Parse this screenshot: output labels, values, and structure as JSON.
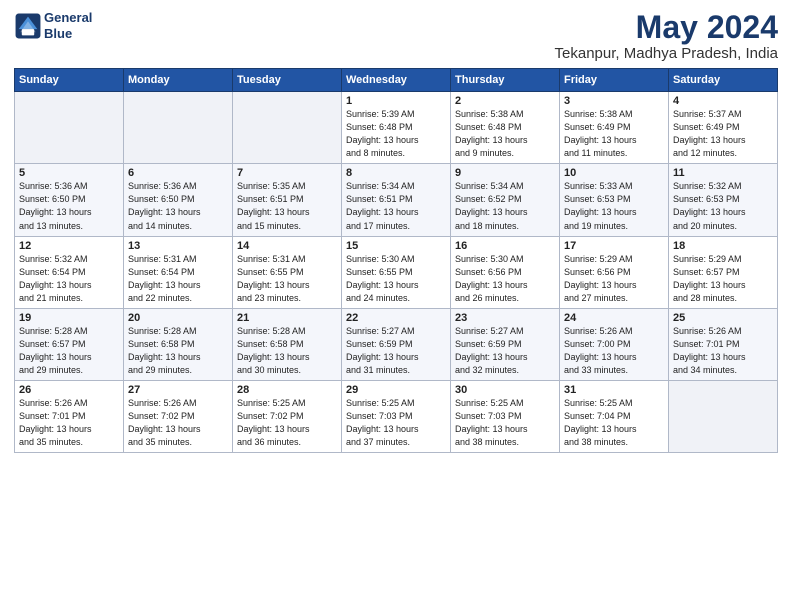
{
  "header": {
    "logo_line1": "General",
    "logo_line2": "Blue",
    "title": "May 2024",
    "subtitle": "Tekanpur, Madhya Pradesh, India"
  },
  "weekdays": [
    "Sunday",
    "Monday",
    "Tuesday",
    "Wednesday",
    "Thursday",
    "Friday",
    "Saturday"
  ],
  "weeks": [
    [
      {
        "day": "",
        "detail": ""
      },
      {
        "day": "",
        "detail": ""
      },
      {
        "day": "",
        "detail": ""
      },
      {
        "day": "1",
        "detail": "Sunrise: 5:39 AM\nSunset: 6:48 PM\nDaylight: 13 hours\nand 8 minutes."
      },
      {
        "day": "2",
        "detail": "Sunrise: 5:38 AM\nSunset: 6:48 PM\nDaylight: 13 hours\nand 9 minutes."
      },
      {
        "day": "3",
        "detail": "Sunrise: 5:38 AM\nSunset: 6:49 PM\nDaylight: 13 hours\nand 11 minutes."
      },
      {
        "day": "4",
        "detail": "Sunrise: 5:37 AM\nSunset: 6:49 PM\nDaylight: 13 hours\nand 12 minutes."
      }
    ],
    [
      {
        "day": "5",
        "detail": "Sunrise: 5:36 AM\nSunset: 6:50 PM\nDaylight: 13 hours\nand 13 minutes."
      },
      {
        "day": "6",
        "detail": "Sunrise: 5:36 AM\nSunset: 6:50 PM\nDaylight: 13 hours\nand 14 minutes."
      },
      {
        "day": "7",
        "detail": "Sunrise: 5:35 AM\nSunset: 6:51 PM\nDaylight: 13 hours\nand 15 minutes."
      },
      {
        "day": "8",
        "detail": "Sunrise: 5:34 AM\nSunset: 6:51 PM\nDaylight: 13 hours\nand 17 minutes."
      },
      {
        "day": "9",
        "detail": "Sunrise: 5:34 AM\nSunset: 6:52 PM\nDaylight: 13 hours\nand 18 minutes."
      },
      {
        "day": "10",
        "detail": "Sunrise: 5:33 AM\nSunset: 6:53 PM\nDaylight: 13 hours\nand 19 minutes."
      },
      {
        "day": "11",
        "detail": "Sunrise: 5:32 AM\nSunset: 6:53 PM\nDaylight: 13 hours\nand 20 minutes."
      }
    ],
    [
      {
        "day": "12",
        "detail": "Sunrise: 5:32 AM\nSunset: 6:54 PM\nDaylight: 13 hours\nand 21 minutes."
      },
      {
        "day": "13",
        "detail": "Sunrise: 5:31 AM\nSunset: 6:54 PM\nDaylight: 13 hours\nand 22 minutes."
      },
      {
        "day": "14",
        "detail": "Sunrise: 5:31 AM\nSunset: 6:55 PM\nDaylight: 13 hours\nand 23 minutes."
      },
      {
        "day": "15",
        "detail": "Sunrise: 5:30 AM\nSunset: 6:55 PM\nDaylight: 13 hours\nand 24 minutes."
      },
      {
        "day": "16",
        "detail": "Sunrise: 5:30 AM\nSunset: 6:56 PM\nDaylight: 13 hours\nand 26 minutes."
      },
      {
        "day": "17",
        "detail": "Sunrise: 5:29 AM\nSunset: 6:56 PM\nDaylight: 13 hours\nand 27 minutes."
      },
      {
        "day": "18",
        "detail": "Sunrise: 5:29 AM\nSunset: 6:57 PM\nDaylight: 13 hours\nand 28 minutes."
      }
    ],
    [
      {
        "day": "19",
        "detail": "Sunrise: 5:28 AM\nSunset: 6:57 PM\nDaylight: 13 hours\nand 29 minutes."
      },
      {
        "day": "20",
        "detail": "Sunrise: 5:28 AM\nSunset: 6:58 PM\nDaylight: 13 hours\nand 29 minutes."
      },
      {
        "day": "21",
        "detail": "Sunrise: 5:28 AM\nSunset: 6:58 PM\nDaylight: 13 hours\nand 30 minutes."
      },
      {
        "day": "22",
        "detail": "Sunrise: 5:27 AM\nSunset: 6:59 PM\nDaylight: 13 hours\nand 31 minutes."
      },
      {
        "day": "23",
        "detail": "Sunrise: 5:27 AM\nSunset: 6:59 PM\nDaylight: 13 hours\nand 32 minutes."
      },
      {
        "day": "24",
        "detail": "Sunrise: 5:26 AM\nSunset: 7:00 PM\nDaylight: 13 hours\nand 33 minutes."
      },
      {
        "day": "25",
        "detail": "Sunrise: 5:26 AM\nSunset: 7:01 PM\nDaylight: 13 hours\nand 34 minutes."
      }
    ],
    [
      {
        "day": "26",
        "detail": "Sunrise: 5:26 AM\nSunset: 7:01 PM\nDaylight: 13 hours\nand 35 minutes."
      },
      {
        "day": "27",
        "detail": "Sunrise: 5:26 AM\nSunset: 7:02 PM\nDaylight: 13 hours\nand 35 minutes."
      },
      {
        "day": "28",
        "detail": "Sunrise: 5:25 AM\nSunset: 7:02 PM\nDaylight: 13 hours\nand 36 minutes."
      },
      {
        "day": "29",
        "detail": "Sunrise: 5:25 AM\nSunset: 7:03 PM\nDaylight: 13 hours\nand 37 minutes."
      },
      {
        "day": "30",
        "detail": "Sunrise: 5:25 AM\nSunset: 7:03 PM\nDaylight: 13 hours\nand 38 minutes."
      },
      {
        "day": "31",
        "detail": "Sunrise: 5:25 AM\nSunset: 7:04 PM\nDaylight: 13 hours\nand 38 minutes."
      },
      {
        "day": "",
        "detail": ""
      }
    ]
  ]
}
